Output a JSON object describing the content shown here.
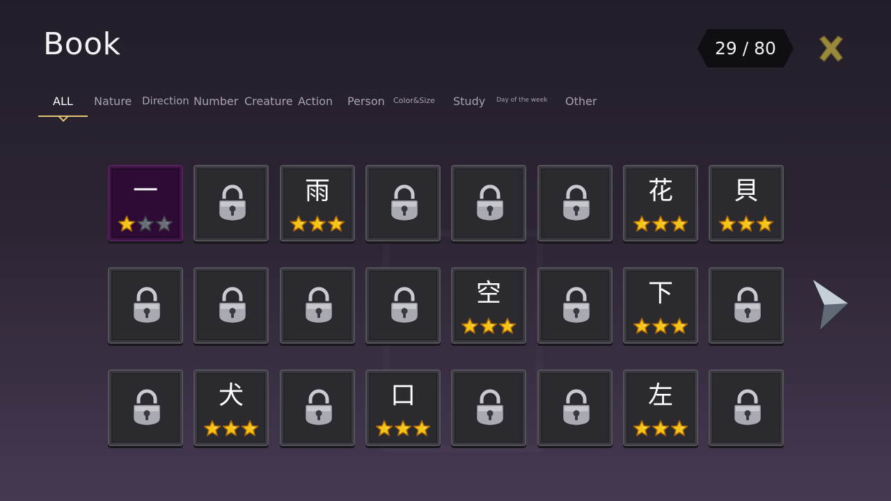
{
  "header": {
    "title": "Book",
    "progress": "29 / 80",
    "unlocked_count": 29,
    "total_count": 80,
    "close_icon": "close-x-icon",
    "accent_color": "#e2c676",
    "close_color": "#9a8a3c"
  },
  "tabs": [
    {
      "label": "ALL",
      "active": true
    },
    {
      "label": "Nature"
    },
    {
      "label": "Direction"
    },
    {
      "label": "Number"
    },
    {
      "label": "Creature"
    },
    {
      "label": "Action"
    },
    {
      "label": "Person"
    },
    {
      "label": "Color&Size"
    },
    {
      "label": "Study"
    },
    {
      "label": "Day of the week"
    },
    {
      "label": "Other"
    }
  ],
  "tiles": [
    {
      "kanji": "一",
      "stars": 1,
      "locked": false,
      "selected": true
    },
    {
      "locked": true
    },
    {
      "kanji": "雨",
      "stars": 3,
      "locked": false
    },
    {
      "locked": true
    },
    {
      "locked": true
    },
    {
      "locked": true
    },
    {
      "kanji": "花",
      "stars": 3,
      "locked": false
    },
    {
      "kanji": "貝",
      "stars": 3,
      "locked": false
    },
    {
      "locked": true
    },
    {
      "locked": true
    },
    {
      "locked": true
    },
    {
      "locked": true
    },
    {
      "kanji": "空",
      "stars": 3,
      "locked": false
    },
    {
      "locked": true
    },
    {
      "kanji": "下",
      "stars": 3,
      "locked": false
    },
    {
      "locked": true
    },
    {
      "locked": true
    },
    {
      "kanji": "犬",
      "stars": 3,
      "locked": false
    },
    {
      "locked": true
    },
    {
      "kanji": "口",
      "stars": 3,
      "locked": false
    },
    {
      "locked": true
    },
    {
      "locked": true
    },
    {
      "kanji": "左",
      "stars": 3,
      "locked": false
    },
    {
      "locked": true
    }
  ],
  "max_stars": 3,
  "icons": {
    "lock": "padlock-icon",
    "star": "star-icon",
    "next": "next-page-arrow-icon"
  },
  "colors": {
    "star_filled": "#f6c417",
    "star_empty": "#6b6d78",
    "tile_bg": "#2b2a2f",
    "tile_selected_bg": "#2e0b34"
  }
}
